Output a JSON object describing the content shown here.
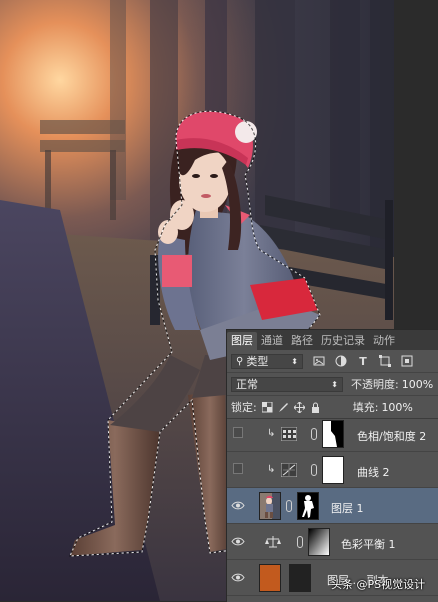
{
  "panel": {
    "tabs": [
      "图层",
      "通道",
      "路径",
      "历史记录",
      "动作"
    ],
    "active_tab": 0,
    "filter_select": "类型",
    "blend_mode": "正常",
    "opacity_label": "不透明度:",
    "opacity_value": "100%",
    "lock_label": "锁定:",
    "fill_label": "填充:",
    "fill_value": "100%"
  },
  "layers": [
    {
      "name": "色相/饱和度 2",
      "visible": false,
      "clipped": true,
      "type": "hue-saturation-adjustment",
      "selected": false
    },
    {
      "name": "曲线 2",
      "visible": false,
      "clipped": true,
      "type": "curves-adjustment",
      "selected": false
    },
    {
      "name": "图层 1",
      "visible": true,
      "clipped": false,
      "type": "pixel-layer",
      "selected": true
    },
    {
      "name": "色彩平衡 1",
      "visible": true,
      "clipped": false,
      "type": "color-balance-adjustment",
      "selected": false
    },
    {
      "name": "图层 ... 副本",
      "visible": true,
      "clipped": false,
      "type": "pixel-layer",
      "selected": false
    }
  ],
  "watermark": "头条 @PS视觉设计",
  "colors": {
    "panel_bg": "#535353",
    "tab_bar_bg": "#3a3a3a",
    "selected_layer": "#596b82",
    "hat": "#e0486a",
    "belt": "#d8283c",
    "dress": "#6f7590",
    "boots": "#6a4e42",
    "fill_swatch": "#c25a1e"
  }
}
